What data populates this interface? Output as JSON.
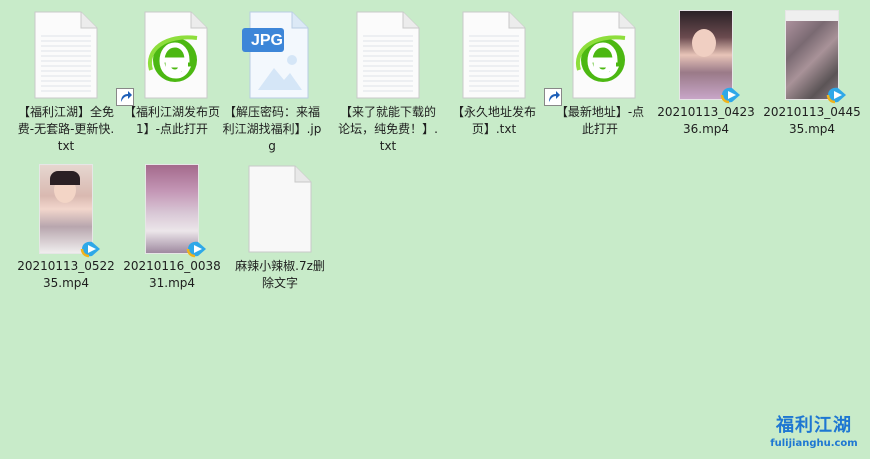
{
  "files": [
    {
      "name": "【福利江湖】全免费-无套路-更新快.txt",
      "type": "txt",
      "icon": "text-file-icon"
    },
    {
      "name": "【福利江湖发布页1】-点此打开",
      "type": "shortcut",
      "icon": "browser-e-icon"
    },
    {
      "name": "【解压密码：来福利江湖找福利】.jpg",
      "type": "jpg",
      "icon": "jpg-file-icon",
      "badge": "JPG"
    },
    {
      "name": "【来了就能下载的论坛，纯免费！】.txt",
      "type": "txt",
      "icon": "text-file-icon"
    },
    {
      "name": "【永久地址发布页】.txt",
      "type": "txt",
      "icon": "text-file-icon"
    },
    {
      "name": "【最新地址】-点此打开",
      "type": "shortcut",
      "icon": "browser-e-icon"
    },
    {
      "name": "20210113_042336.mp4",
      "type": "mp4",
      "icon": "video-thumbnail"
    },
    {
      "name": "20210113_044535.mp4",
      "type": "mp4",
      "icon": "video-thumbnail"
    },
    {
      "name": "20210113_052235.mp4",
      "type": "mp4",
      "icon": "video-thumbnail"
    },
    {
      "name": "20210116_003831.mp4",
      "type": "mp4",
      "icon": "video-thumbnail"
    },
    {
      "name": "麻辣小辣椒.7z删除文字",
      "type": "7z",
      "icon": "blank-file-icon"
    }
  ],
  "watermark": {
    "title": "福利江湖",
    "url": "fulijianghu.com"
  },
  "colors": {
    "background": "#c8ebc9",
    "brand": "#1e77d2",
    "ie_green": "#4cb812"
  }
}
